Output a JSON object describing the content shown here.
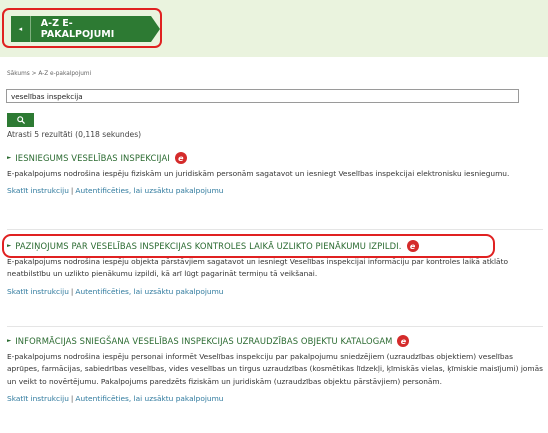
{
  "banner": {
    "toggle_icon": "chevron-left-icon",
    "toggle_glyph": "◂",
    "title": "A-Z E-PAKALPOJUMI"
  },
  "breadcrumb": {
    "home": "Sākums",
    "separator": " > ",
    "current": "A-Z e-pakalpojumi"
  },
  "search": {
    "value": "veselības inspekcija",
    "button_icon": "search-icon"
  },
  "results_count": "Atrasti 5 rezultāti (0,118 sekundes)",
  "results": [
    {
      "title": "IESNIEGUMS VESELĪBAS INSPEKCIJAI",
      "badge": "e",
      "description": "E-pakalpojums nodrošina iespēju fiziskām un juridiskām personām sagatavot un iesniegt Veselības inspekcijai elektronisku iesniegumu.",
      "link_instructions": "Skatīt instrukciju",
      "link_separator": "|",
      "link_auth": "Autentificēties, lai uzsāktu pakalpojumu"
    },
    {
      "title": "PAZIŅOJUMS PAR VESELĪBAS INSPEKCIJAS KONTROLES LAIKĀ UZLIKTO PIENĀKUMU IZPILDI.",
      "badge": "e",
      "description": "E-pakalpojums nodrošina iespēju objekta pārstāvjiem sagatavot un iesniegt Veselības inspekcijai informāciju par kontroles laikā atklāto neatbilstību un uzlikto pienākumu izpildi, kā arī lūgt pagarināt termiņu tā veikšanai.",
      "link_instructions": "Skatīt instrukciju",
      "link_separator": "|",
      "link_auth": "Autentificēties, lai uzsāktu pakalpojumu"
    },
    {
      "title": "INFORMĀCIJAS SNIEGŠANA VESELĪBAS INSPEKCIJAS UZRAUDZĪBAS OBJEKTU KATALOGAM",
      "badge": "e",
      "description": "E-pakalpojums nodrošina iespēju personai informēt Veselības inspekciju par pakalpojumu sniedzējiem (uzraudzības objektiem) veselības aprūpes, farmācijas, sabiedrības veselības, vides veselības un tirgus uzraudzības (kosmētikas līdzekļi, ķīmiskās vielas, ķīmiskie maisījumi) jomās un veikt to novērtējumu. Pakalpojums paredzēts fiziskām un juridiskām (uzraudzības objektu pārstāvjiem) personām.",
      "link_instructions": "Skatīt instrukciju",
      "link_separator": "|",
      "link_auth": "Autentificēties, lai uzsāktu pakalpojumu"
    }
  ],
  "colors": {
    "brand_green": "#2d7a33",
    "banner_bg": "#eaf3de",
    "highlight_red": "#e02121",
    "link_blue": "#2f7a9e",
    "badge_red": "#d42b2b"
  }
}
